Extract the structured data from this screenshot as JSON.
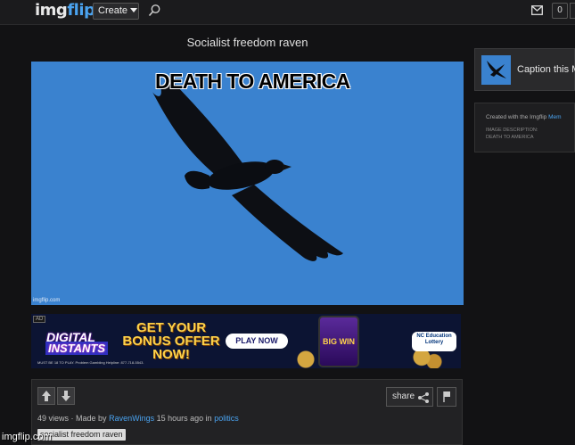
{
  "topbar": {
    "logo_main": "img",
    "logo_accent": "flip",
    "create_label": "Create",
    "notifications_count": "0"
  },
  "page": {
    "title": "Socialist freedom raven"
  },
  "meme": {
    "caption": "DEATH TO AMERICA",
    "watermark": "imgflip.com"
  },
  "ad": {
    "label": "AD",
    "brand_line1": "DIGITAL",
    "brand_line2": "INSTANTS",
    "offer_text": "GET YOUR BONUS OFFER NOW!",
    "play_label": "PLAY NOW",
    "phone_text": "BIG WIN",
    "lottery_text": "NC Education Lottery",
    "fine_print": "MUST BE 18 TO PLAY. Problem Gambling Helpline: 877-718-5543."
  },
  "meta": {
    "views": "49 views",
    "made_by_prefix": "· Made by",
    "author": "RavenWings",
    "time": "15 hours ago in",
    "category": "politics",
    "tag": "socialist freedom raven",
    "share_label": "share"
  },
  "sidebar": {
    "caption_label": "Caption this M",
    "created_prefix": "Created with the Imgflip",
    "created_link": "Mem",
    "image_desc_label": "IMAGE DESCRIPTION:",
    "image_desc": "DEATH TO AMERICA"
  },
  "site_watermark": "imgflip.com",
  "colors": {
    "accent": "#4aa3f0",
    "sky": "#3a82cf",
    "background": "#121214"
  }
}
